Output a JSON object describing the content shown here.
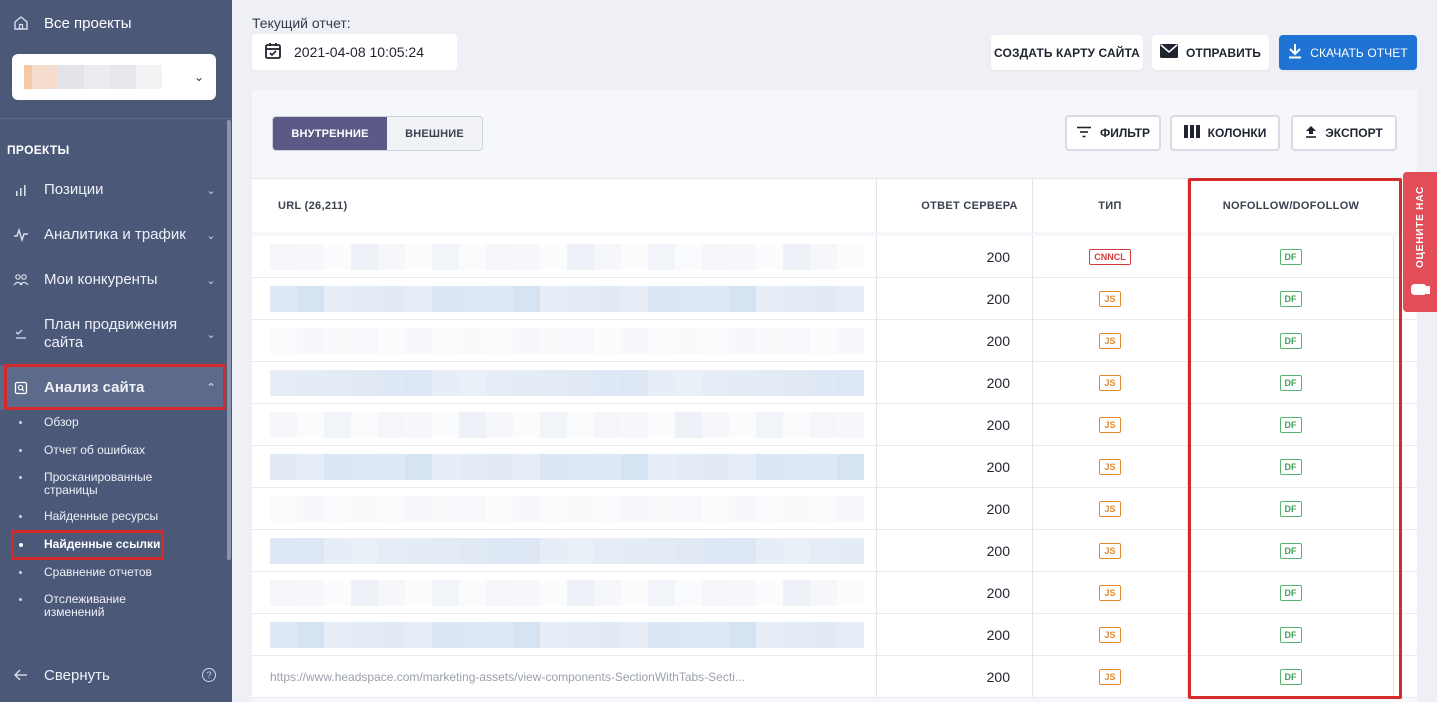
{
  "sidebar": {
    "all_projects": "Все проекты",
    "section_title": "ПРОЕКТЫ",
    "nav": [
      {
        "label": "Позиции",
        "icon": "bar-chart-icon"
      },
      {
        "label": "Аналитика и трафик",
        "icon": "pulse-icon"
      },
      {
        "label": "Мои конкуренты",
        "icon": "people-icon"
      },
      {
        "label": "План продвижения сайта",
        "icon": "checklist-icon"
      },
      {
        "label": "Анализ сайта",
        "icon": "site-audit-icon"
      }
    ],
    "sub_items": [
      "Обзор",
      "Отчет об ошибках",
      "Просканированные страницы",
      "Найденные ресурсы",
      "Найденные ссылки",
      "Сравнение отчетов",
      "Отслеживание изменений"
    ],
    "active_sub": "Найденные ссылки",
    "collapse": "Свернуть"
  },
  "header": {
    "report_label": "Текущий отчет:",
    "report_date": "2021-04-08 10:05:24",
    "buttons": {
      "sitemap": "СОЗДАТЬ КАРТУ САЙТА",
      "send": "ОТПРАВИТЬ",
      "download": "СКАЧАТЬ ОТЧЕТ"
    }
  },
  "toolbar": {
    "tab_internal": "ВНУТРЕННИЕ",
    "tab_external": "ВНЕШНИЕ",
    "filter": "ФИЛЬТР",
    "columns": "КОЛОНКИ",
    "export": "ЭКСПОРТ"
  },
  "table": {
    "columns": [
      "URL  (26,211)",
      "ОТВЕТ СЕРВЕРА",
      "ТИП",
      "NOFOLLOW/DOFOLLOW"
    ],
    "rows": [
      {
        "status": "200",
        "type": "CNNCL",
        "follow": "DF"
      },
      {
        "status": "200",
        "type": "JS",
        "follow": "DF"
      },
      {
        "status": "200",
        "type": "JS",
        "follow": "DF"
      },
      {
        "status": "200",
        "type": "JS",
        "follow": "DF"
      },
      {
        "status": "200",
        "type": "JS",
        "follow": "DF"
      },
      {
        "status": "200",
        "type": "JS",
        "follow": "DF"
      },
      {
        "status": "200",
        "type": "JS",
        "follow": "DF"
      },
      {
        "status": "200",
        "type": "JS",
        "follow": "DF"
      },
      {
        "status": "200",
        "type": "JS",
        "follow": "DF"
      },
      {
        "status": "200",
        "type": "JS",
        "follow": "DF"
      },
      {
        "status": "200",
        "type": "JS",
        "follow": "DF"
      }
    ],
    "last_url_fragment": "https://www.headspace.com/marketing-assets/view-components-SectionWithTabs-Secti..."
  },
  "rate_tab": "ОЦЕНИТЕ НАС",
  "colors": {
    "sidebar": "#4b5878",
    "accent_blue": "#1f73d3",
    "segment_active": "#5c5987",
    "highlight_red": "#d32a2a"
  }
}
